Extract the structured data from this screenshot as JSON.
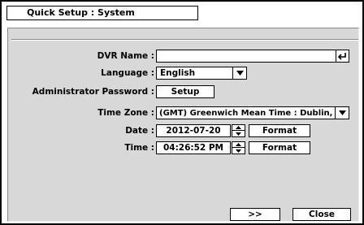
{
  "window": {
    "title": "Quick Setup : System"
  },
  "form": {
    "dvr_name": {
      "label": "DVR Name :",
      "value": ""
    },
    "language": {
      "label": "Language :",
      "value": "English"
    },
    "admin_password": {
      "label": "Administrator Password :",
      "button": "Setup"
    },
    "time_zone": {
      "label": "Time Zone :",
      "value": "(GMT) Greenwich Mean Time : Dublin,"
    },
    "date": {
      "label": "Date :",
      "value": "2012-07-20",
      "format_button": "Format"
    },
    "time": {
      "label": "Time :",
      "value": "04:26:52 PM",
      "format_button": "Format"
    }
  },
  "footer": {
    "next_label": ">>",
    "close_label": "Close"
  },
  "icons": {
    "enter": "enter-key-icon",
    "dropdown": "dropdown-arrow-icon",
    "spin_up": "spin-up-icon",
    "spin_down": "spin-down-icon"
  }
}
